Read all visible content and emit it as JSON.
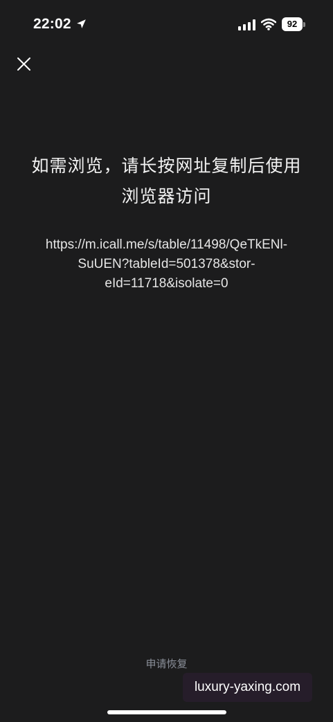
{
  "status_bar": {
    "time": "22:02",
    "battery_level": "92",
    "icons": [
      "location-arrow-icon",
      "cellular-signal-icon",
      "wifi-icon",
      "battery-icon"
    ]
  },
  "toolbar": {
    "close_icon": "close-icon"
  },
  "main": {
    "title_line1": "如需浏览，请长按网址复制后使用",
    "title_line2": "浏览器访问",
    "url_line1": "https://m.icall.me/s/table/11498/QeTkENl-",
    "url_line2": "SuUEN?tableId=501378&stor-",
    "url_line3": "eId=11718&isolate=0"
  },
  "footer": {
    "restore_label": "申请恢复",
    "watermark": "luxury-yaxing.com"
  },
  "colors": {
    "background": "#1c1c1d",
    "text": "#ffffff",
    "muted_link": "#8a8f99"
  }
}
